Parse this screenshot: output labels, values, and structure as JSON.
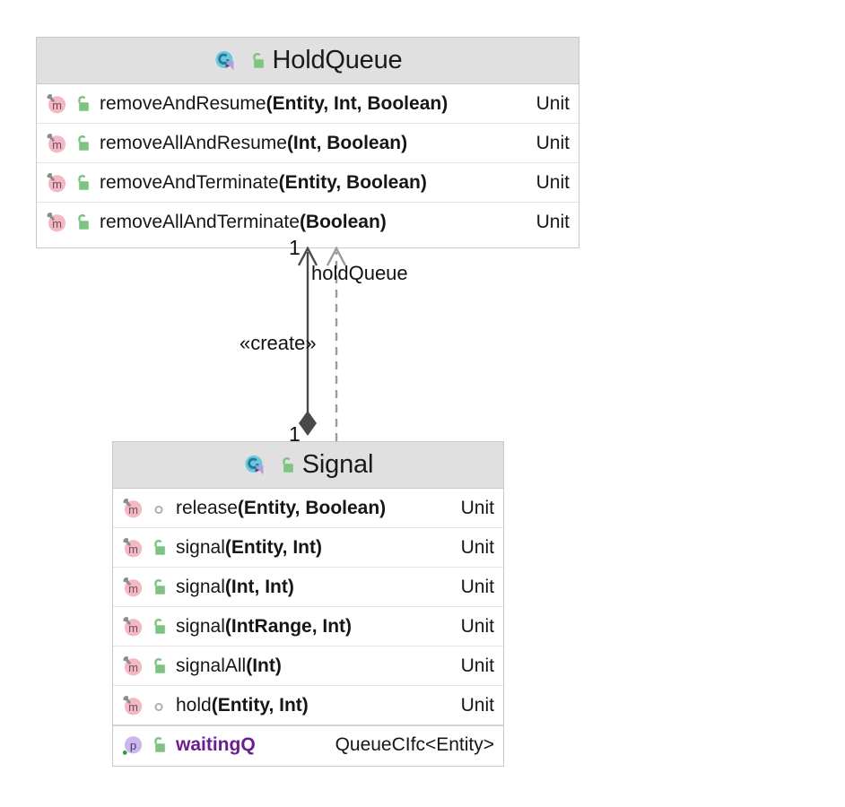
{
  "diagram": {
    "type": "uml-class-diagram",
    "background": "#ffffff",
    "header_fill": "#e0e0e0",
    "border_color": "#c8c8c8",
    "method_icon_color": "#f4b8c4",
    "property_icon_color": "#cbb6ee",
    "class_icon_color": "#6ecbe0",
    "lock_color": "#7cc47f",
    "property_name_color": "#6c1d8f"
  },
  "classes": [
    {
      "id": "holdqueue",
      "name": "HoldQueue",
      "kind_icon": "class-icon",
      "visibility_icon": "unlocked-padlock-icon",
      "members": [
        {
          "kind_icon": "method-icon",
          "visibility_icon": "unlocked-padlock-icon",
          "name": "removeAndResume",
          "params": "(Entity, Int, Boolean)",
          "type": "Unit"
        },
        {
          "kind_icon": "method-icon",
          "visibility_icon": "unlocked-padlock-icon",
          "name": "removeAllAndResume",
          "params": "(Int, Boolean)",
          "type": "Unit"
        },
        {
          "kind_icon": "method-icon",
          "visibility_icon": "unlocked-padlock-icon",
          "name": "removeAndTerminate",
          "params": "(Entity, Boolean)",
          "type": "Unit"
        },
        {
          "kind_icon": "method-icon",
          "visibility_icon": "unlocked-padlock-icon",
          "name": "removeAllAndTerminate",
          "params": "(Boolean)",
          "type": "Unit"
        }
      ]
    },
    {
      "id": "signal",
      "name": "Signal",
      "kind_icon": "class-icon",
      "visibility_icon": "unlocked-padlock-icon",
      "members": [
        {
          "kind_icon": "method-icon",
          "visibility_icon": "protected-circle-icon",
          "name": "release",
          "params": "(Entity, Boolean)",
          "type": "Unit"
        },
        {
          "kind_icon": "method-icon",
          "visibility_icon": "unlocked-padlock-icon",
          "name": "signal",
          "params": "(Entity, Int)",
          "type": "Unit"
        },
        {
          "kind_icon": "method-icon",
          "visibility_icon": "unlocked-padlock-icon",
          "name": "signal",
          "params": "(Int, Int)",
          "type": "Unit"
        },
        {
          "kind_icon": "method-icon",
          "visibility_icon": "unlocked-padlock-icon",
          "name": "signal",
          "params": "(IntRange, Int)",
          "type": "Unit"
        },
        {
          "kind_icon": "method-icon",
          "visibility_icon": "unlocked-padlock-icon",
          "name": "signalAll",
          "params": "(Int)",
          "type": "Unit"
        },
        {
          "kind_icon": "method-icon",
          "visibility_icon": "protected-circle-icon",
          "name": "hold",
          "params": "(Entity, Int)",
          "type": "Unit"
        },
        {
          "kind_icon": "property-icon",
          "visibility_icon": "unlocked-padlock-icon",
          "name": "waitingQ",
          "params": "",
          "type": "QueueCIfc<Entity>",
          "is_property": true
        }
      ]
    }
  ],
  "relationships": [
    {
      "id": "composition",
      "style": "solid",
      "source": "signal",
      "target": "holdqueue",
      "source_decoration": "filled-diamond",
      "target_decoration": "open-arrow",
      "label": "«create»",
      "source_multiplicity": "1",
      "target_multiplicity": "1"
    },
    {
      "id": "dependency",
      "style": "dashed",
      "source": "signal",
      "target": "holdqueue",
      "source_decoration": "none",
      "target_decoration": "open-arrow",
      "label": "holdQueue",
      "source_multiplicity": "",
      "target_multiplicity": ""
    }
  ]
}
